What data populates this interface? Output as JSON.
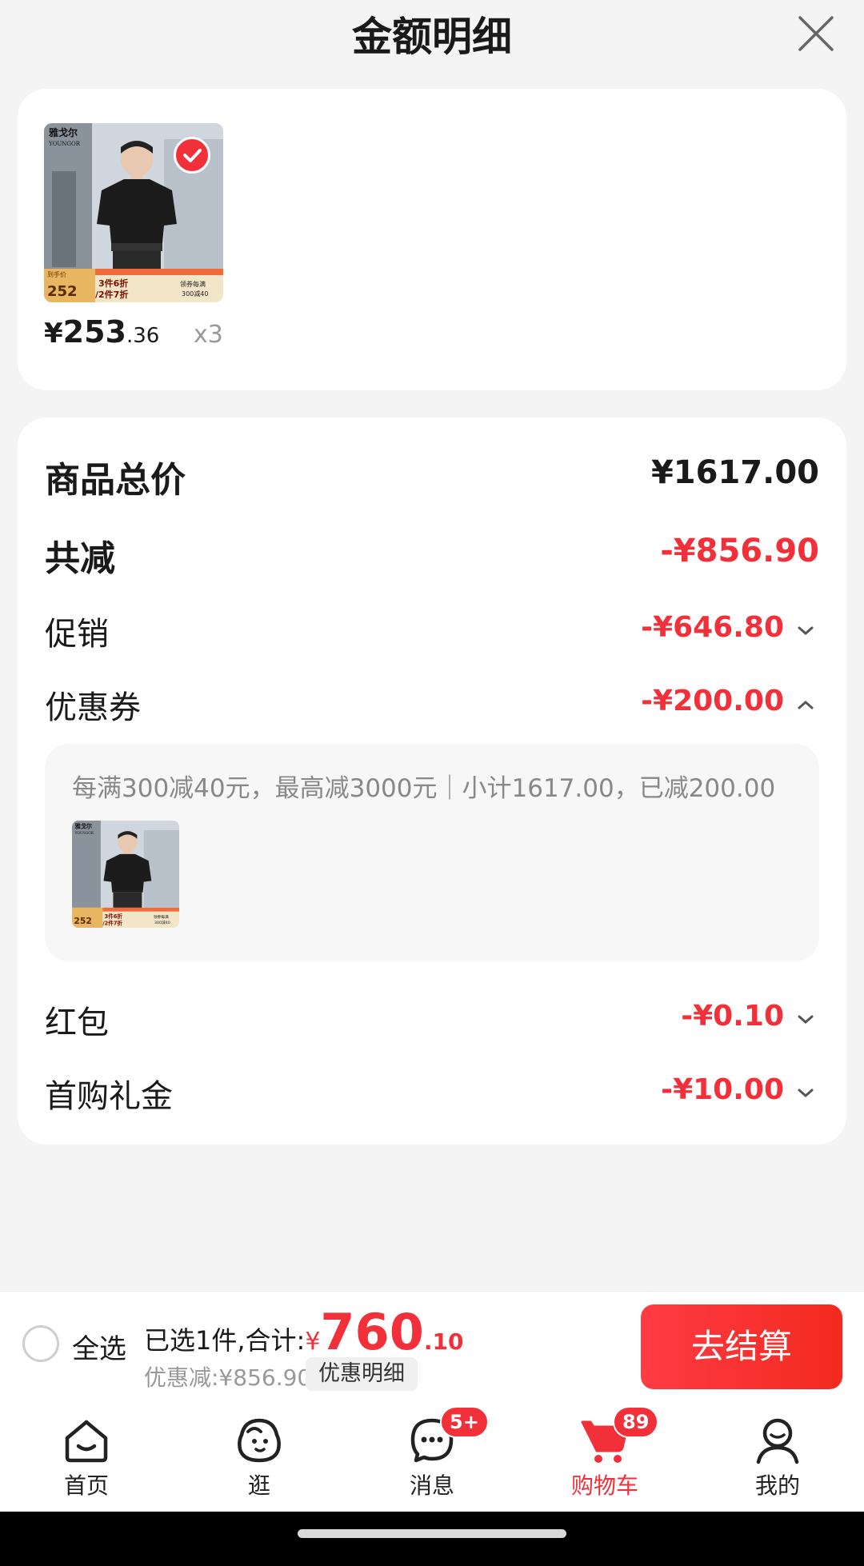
{
  "header": {
    "title": "金额明细"
  },
  "product": {
    "price_currency": "¥",
    "price_int": "253",
    "price_dec": ".36",
    "quantity": "x3",
    "brand": "雅戈尔",
    "brand_en": "YOUNGOR",
    "promo_price": "252",
    "promo_text1": "3件6折",
    "promo_text2": "/2件7折",
    "promo_coupon": "领券每满",
    "promo_coupon2": "300减40"
  },
  "breakdown": {
    "total_label": "商品总价",
    "total_value": "¥1617.00",
    "reduced_label": "共减",
    "reduced_value": "-¥856.90",
    "promo_label": "促销",
    "promo_value": "-¥646.80",
    "coupon_label": "优惠券",
    "coupon_value": "-¥200.00",
    "coupon_desc": "每满300减40元，最高减3000元｜小计1617.00，已减200.00",
    "redpacket_label": "红包",
    "redpacket_value": "-¥0.10",
    "firstbuy_label": "首购礼金",
    "firstbuy_value": "-¥10.00"
  },
  "checkout": {
    "select_all": "全选",
    "selected_prefix": "已选1件,合计:",
    "total_currency": "¥",
    "total_int": "760",
    "total_dec": ".10",
    "discount_text": "优惠减:¥856.90",
    "detail_button": "优惠明细",
    "checkout_button": "去结算"
  },
  "tabs": [
    {
      "label": "首页",
      "icon": "home-icon"
    },
    {
      "label": "逛",
      "icon": "browse-icon"
    },
    {
      "label": "消息",
      "icon": "message-icon",
      "badge": "5+"
    },
    {
      "label": "购物车",
      "icon": "cart-icon",
      "badge": "89",
      "active": true
    },
    {
      "label": "我的",
      "icon": "profile-icon"
    }
  ],
  "colors": {
    "accent": "#f2303a",
    "background": "#f4f4f4"
  }
}
